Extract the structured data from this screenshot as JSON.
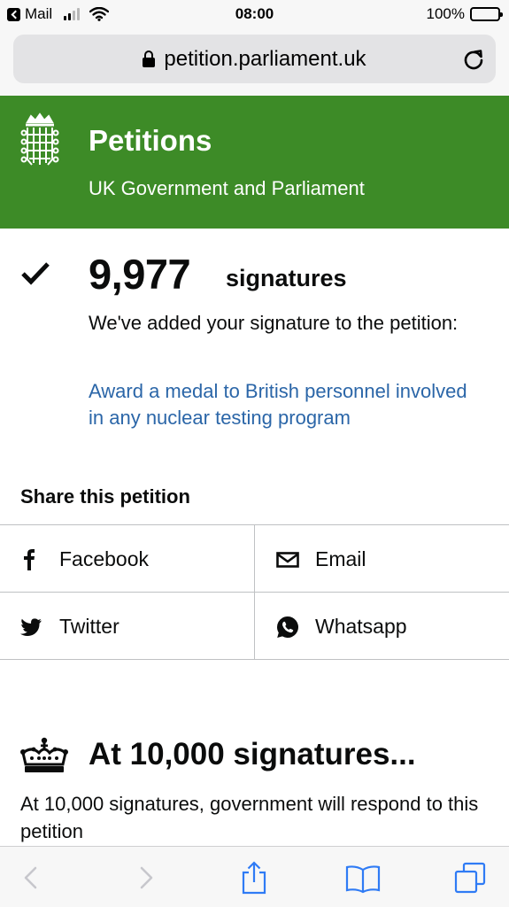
{
  "status_bar": {
    "back_app": "Mail",
    "time": "08:00",
    "battery": "100%"
  },
  "browser": {
    "url": "petition.parliament.uk"
  },
  "header": {
    "title": "Petitions",
    "subtitle": "UK Government and Parliament"
  },
  "signed": {
    "count": "9,977",
    "count_label": "signatures",
    "message": "We've added your signature to the petition:",
    "petition_title": "Award a medal to British personnel involved in any nuclear testing program"
  },
  "share": {
    "heading": "Share this petition",
    "items": [
      {
        "label": "Facebook",
        "icon": "facebook-icon"
      },
      {
        "label": "Email",
        "icon": "email-icon"
      },
      {
        "label": "Twitter",
        "icon": "twitter-icon"
      },
      {
        "label": "Whatsapp",
        "icon": "whatsapp-icon"
      }
    ]
  },
  "threshold": {
    "heading": "At 10,000 signatures...",
    "text": "At 10,000 signatures, government will respond to this petition"
  },
  "colors": {
    "header_green": "#3d8b27",
    "link_blue": "#2b66a8",
    "ios_blue": "#2f7bf5"
  }
}
